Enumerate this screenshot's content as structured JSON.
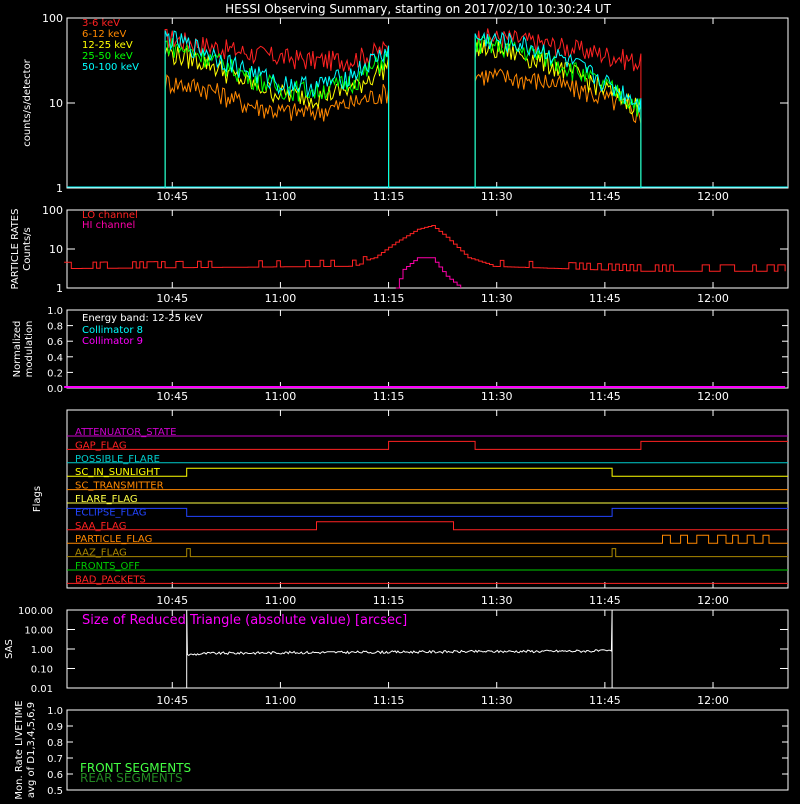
{
  "title": "HESSI Observing Summary, starting on 2017/02/10 10:30:24 UT",
  "chart_data": [
    {
      "id": "lightcurve",
      "type": "line",
      "ylabel": "counts/s/detector",
      "yscale": "log",
      "ylim": [
        1,
        100
      ],
      "ytick_labels": [
        "1",
        "10",
        "100"
      ],
      "xlim": [
        "10:30:24",
        "12:10:24"
      ],
      "xtick_labels": [
        "10:45",
        "11:00",
        "11:15",
        "11:30",
        "11:45",
        "12:00"
      ],
      "legend_position": "top-left",
      "data_gaps": [
        [
          "10:30:24",
          "10:44:00"
        ],
        [
          "11:15:00",
          "11:27:00"
        ],
        [
          "11:50:00",
          "12:10:24"
        ]
      ],
      "series": [
        {
          "name": "3-6 keV",
          "color": "#ff2222",
          "x": [
            "10:44",
            "10:50",
            "10:55",
            "11:00",
            "11:05",
            "11:10",
            "11:15",
            "11:27",
            "11:32",
            "11:37",
            "11:42",
            "11:47",
            "11:50"
          ],
          "values": [
            60,
            48,
            40,
            35,
            32,
            33,
            45,
            60,
            58,
            50,
            42,
            35,
            30
          ]
        },
        {
          "name": "6-12 keV",
          "color": "#ff8800",
          "x": [
            "10:44",
            "10:50",
            "10:55",
            "11:00",
            "11:05",
            "11:10",
            "11:15",
            "11:27",
            "11:32",
            "11:37",
            "11:42",
            "11:47",
            "11:50"
          ],
          "values": [
            18,
            15,
            10,
            8,
            8,
            10,
            14,
            22,
            20,
            18,
            14,
            10,
            7
          ]
        },
        {
          "name": "12-25 keV",
          "color": "#ffff00",
          "x": [
            "10:44",
            "10:50",
            "10:55",
            "11:00",
            "11:05",
            "11:10",
            "11:15",
            "11:27",
            "11:32",
            "11:37",
            "11:42",
            "11:47",
            "11:50"
          ],
          "values": [
            40,
            30,
            18,
            13,
            12,
            15,
            28,
            45,
            40,
            30,
            20,
            12,
            9
          ]
        },
        {
          "name": "25-50 keV",
          "color": "#00ff00",
          "x": [
            "10:44",
            "10:50",
            "10:55",
            "11:00",
            "11:05",
            "11:10",
            "11:15",
            "11:27",
            "11:32",
            "11:37",
            "11:42",
            "11:47",
            "11:50"
          ],
          "values": [
            50,
            35,
            22,
            15,
            14,
            18,
            35,
            50,
            45,
            35,
            22,
            13,
            9
          ]
        },
        {
          "name": "50-100 keV",
          "color": "#00ffff",
          "x": [
            "10:44",
            "10:50",
            "10:55",
            "11:00",
            "11:05",
            "11:10",
            "11:15",
            "11:27",
            "11:32",
            "11:37",
            "11:42",
            "11:47",
            "11:50"
          ],
          "values": [
            60,
            40,
            25,
            17,
            16,
            22,
            42,
            58,
            52,
            40,
            25,
            14,
            10
          ]
        }
      ]
    },
    {
      "id": "particle",
      "type": "line",
      "ylabel_lines": [
        "PARTICLE RATES",
        "Counts/s"
      ],
      "yscale": "log",
      "ylim": [
        1,
        100
      ],
      "ytick_labels": [
        "1",
        "10",
        "100"
      ],
      "xtick_labels": [
        "10:45",
        "11:00",
        "11:15",
        "11:30",
        "11:45",
        "12:00"
      ],
      "legend_position": "top-left",
      "series": [
        {
          "name": "LO channel",
          "color": "#ff2222",
          "x": [
            "10:30",
            "11:10",
            "11:13",
            "11:16",
            "11:19",
            "11:21",
            "11:23",
            "11:26",
            "11:29",
            "11:50",
            "12:10"
          ],
          "values": [
            3.5,
            4,
            6,
            15,
            32,
            40,
            20,
            6,
            4,
            3,
            3
          ]
        },
        {
          "name": "HI channel",
          "color": "#ff00aa",
          "x": [
            "11:16",
            "11:17",
            "11:19",
            "11:21",
            "11:23",
            "11:25"
          ],
          "values": [
            1,
            3,
            6,
            6,
            2,
            1
          ]
        }
      ]
    },
    {
      "id": "modulation",
      "type": "line",
      "ylabel_lines": [
        "Normalized",
        "modulation"
      ],
      "ylim": [
        0,
        1
      ],
      "ytick_labels": [
        "0.0",
        "0.2",
        "0.4",
        "0.6",
        "0.8",
        "1.0"
      ],
      "xtick_labels": [
        "10:45",
        "11:00",
        "11:15",
        "11:30",
        "11:45",
        "12:00"
      ],
      "annotation": "Energy band: 12-25 keV",
      "legend_position": "top-left",
      "series": [
        {
          "name": "Collimator 8",
          "color": "#00ffff",
          "x": [],
          "values": []
        },
        {
          "name": "Collimator 9",
          "color": "#ff00ff",
          "x": [
            "10:30",
            "12:10"
          ],
          "values": [
            0,
            0
          ]
        }
      ]
    },
    {
      "id": "flags",
      "type": "line",
      "ylabel": "Flags",
      "xtick_labels": [
        "10:45",
        "11:00",
        "11:15",
        "11:30",
        "11:45",
        "12:00"
      ],
      "flags": [
        {
          "name": "ATTENUATOR_STATE",
          "color": "#cc00cc",
          "transitions": []
        },
        {
          "name": "GAP_FLAG",
          "color": "#ff2222",
          "transitions": [
            [
              "11:15",
              1
            ],
            [
              "11:27",
              0
            ],
            [
              "11:50",
              1
            ]
          ]
        },
        {
          "name": "POSSIBLE_FLARE",
          "color": "#00cccc",
          "transitions": []
        },
        {
          "name": "SC_IN_SUNLIGHT",
          "color": "#ffff00",
          "transitions": [
            [
              "10:47",
              1
            ],
            [
              "11:46",
              0
            ]
          ]
        },
        {
          "name": "SC_TRANSMITTER",
          "color": "#ff8800",
          "transitions": []
        },
        {
          "name": "FLARE_FLAG",
          "color": "#ffff44",
          "transitions": []
        },
        {
          "name": "ECLIPSE_FLAG",
          "color": "#2244ff",
          "transitions": [
            [
              "10:47",
              0
            ],
            [
              "11:46",
              1
            ]
          ]
        },
        {
          "name": "SAA_FLAG",
          "color": "#ff2222",
          "transitions": [
            [
              "11:05",
              1
            ],
            [
              "11:24",
              0
            ]
          ]
        },
        {
          "name": "PARTICLE_FLAG",
          "color": "#ff8800",
          "transitions": [
            [
              "11:53",
              1
            ],
            [
              "12:08",
              0
            ]
          ]
        },
        {
          "name": "AAZ_FLAG",
          "color": "#aa8800",
          "transitions": [
            [
              "10:47",
              1
            ],
            [
              "10:47.5",
              0
            ],
            [
              "11:46",
              1
            ],
            [
              "11:46.5",
              0
            ]
          ]
        },
        {
          "name": "FRONTS_OFF",
          "color": "#00cc00",
          "transitions": []
        },
        {
          "name": "BAD_PACKETS",
          "color": "#ff2222",
          "transitions": []
        }
      ]
    },
    {
      "id": "sas",
      "type": "line",
      "ylabel": "SAS",
      "yscale": "log",
      "ylim": [
        0.01,
        100
      ],
      "ytick_labels": [
        "0.01",
        "0.10",
        "1.00",
        "10.00",
        "100.00"
      ],
      "xtick_labels": [
        "10:45",
        "11:00",
        "11:15",
        "11:30",
        "11:45",
        "12:00"
      ],
      "series": [
        {
          "name": "Size of Reduced Triangle (absolute value) [arcsec]",
          "color": "#ffffff",
          "x": [
            "10:47",
            "10:50",
            "11:00",
            "11:15",
            "11:30",
            "11:45",
            "11:46"
          ],
          "values": [
            0.5,
            0.6,
            0.65,
            0.7,
            0.75,
            0.8,
            0.8
          ]
        }
      ]
    },
    {
      "id": "livetime",
      "type": "line",
      "ylabel_lines": [
        "Mon. Rate LIVETIME",
        "avg of D1,3,4,5,6,9"
      ],
      "ylim": [
        0.5,
        1.0
      ],
      "ytick_labels": [
        "0.5",
        "0.6",
        "0.7",
        "0.8",
        "0.9",
        "1.0"
      ],
      "legend_position": "bottom-left",
      "series": [
        {
          "name": "FRONT SEGMENTS",
          "color": "#44ff44",
          "x": [],
          "values": []
        },
        {
          "name": "REAR SEGMENTS",
          "color": "#228822",
          "x": [],
          "values": []
        }
      ]
    }
  ]
}
